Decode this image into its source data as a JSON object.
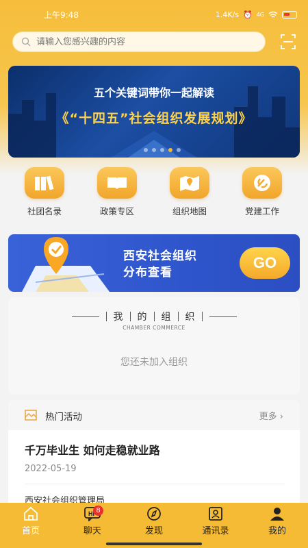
{
  "status_bar": {
    "time": "上午9:48",
    "speed": "1.4K/s",
    "network": "4G"
  },
  "search": {
    "placeholder": "请输入您感兴趣的内容"
  },
  "banner": {
    "line1": "五个关键词带你一起解读",
    "line2": "《“十四五”社会组织发展规划》",
    "active_dot": 3,
    "dot_count": 5
  },
  "quick_links": [
    {
      "label": "社团名录",
      "icon": "books-icon"
    },
    {
      "label": "政策专区",
      "icon": "open-book-icon"
    },
    {
      "label": "组织地图",
      "icon": "map-pin-icon"
    },
    {
      "label": "党建工作",
      "icon": "party-emblem-icon"
    }
  ],
  "map_banner": {
    "title_line1": "西安社会组织",
    "title_line2": "分布查看",
    "go_label": "GO"
  },
  "my_org": {
    "title_chars": [
      "我",
      "的",
      "组",
      "织"
    ],
    "subtitle": "CHAMBER COMMERCE",
    "empty_text": "您还未加入组织"
  },
  "hot_activity": {
    "title": "热门活动",
    "more": "更多",
    "article": {
      "title": "千万毕业生 如何走稳就业路",
      "date": "2022-05-19",
      "source": "西安社会组织管理局"
    }
  },
  "tabs": [
    {
      "label": "首页",
      "icon": "home-icon",
      "active": true
    },
    {
      "label": "聊天",
      "icon": "chat-hi-icon",
      "badge": "8"
    },
    {
      "label": "发现",
      "icon": "compass-icon"
    },
    {
      "label": "通讯录",
      "icon": "contacts-icon"
    },
    {
      "label": "我的",
      "icon": "profile-icon"
    }
  ],
  "colors": {
    "brand": "#f5bb35",
    "banner_blue": "#1c4ea3",
    "badge_red": "#e8312d"
  }
}
